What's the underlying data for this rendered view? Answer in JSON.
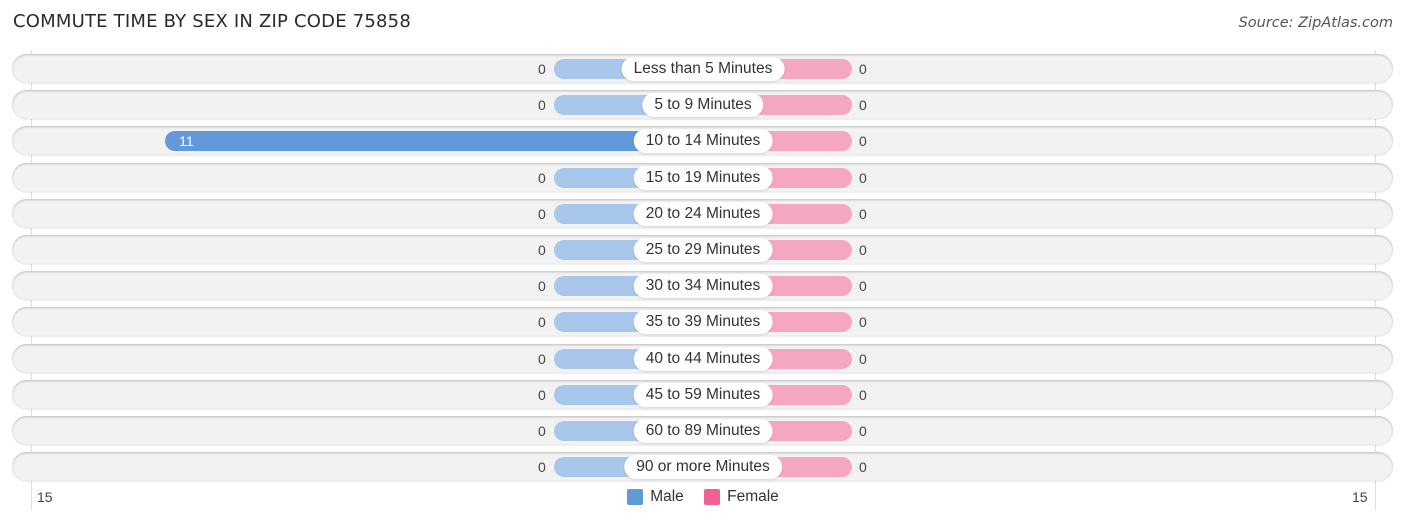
{
  "chart_data": {
    "type": "bar",
    "orientation": "horizontal-diverging",
    "title": "COMMUTE TIME BY SEX IN ZIP CODE 75858",
    "source": "Source: ZipAtlas.com",
    "categories": [
      "Less than 5 Minutes",
      "5 to 9 Minutes",
      "10 to 14 Minutes",
      "15 to 19 Minutes",
      "20 to 24 Minutes",
      "25 to 29 Minutes",
      "30 to 34 Minutes",
      "35 to 39 Minutes",
      "40 to 44 Minutes",
      "45 to 59 Minutes",
      "60 to 89 Minutes",
      "90 or more Minutes"
    ],
    "series": [
      {
        "name": "Male",
        "color": "#6199d9",
        "light_color": "#a9c7eb",
        "values": [
          0,
          0,
          11,
          0,
          0,
          0,
          0,
          0,
          0,
          0,
          0,
          0
        ]
      },
      {
        "name": "Female",
        "color": "#f06292",
        "light_color": "#f6a7c0",
        "values": [
          0,
          0,
          0,
          0,
          0,
          0,
          0,
          0,
          0,
          0,
          0,
          0
        ]
      }
    ],
    "axis": {
      "left_label": "15",
      "right_label": "15",
      "range": [
        -15,
        15
      ]
    },
    "legend": {
      "position": "bottom-center",
      "items": [
        "Male",
        "Female"
      ]
    },
    "grid": true
  }
}
